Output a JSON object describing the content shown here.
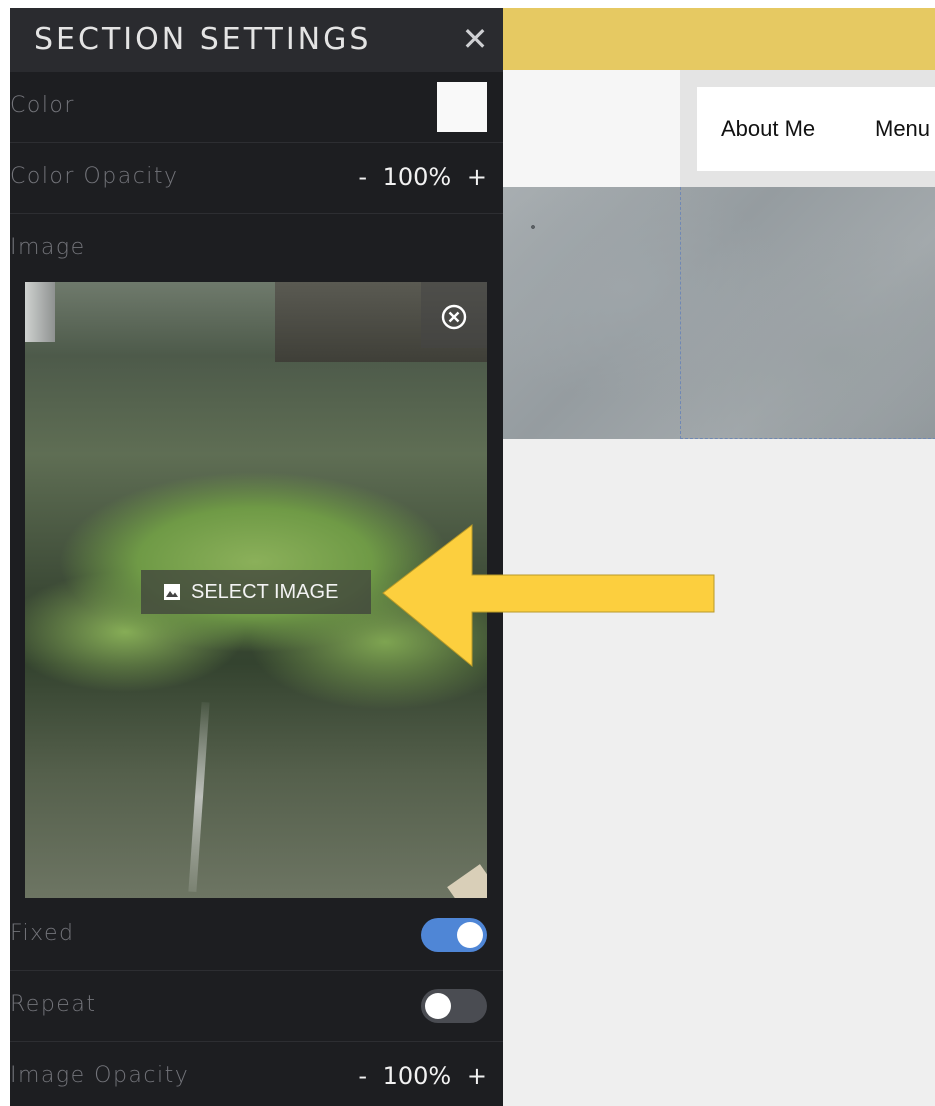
{
  "panel": {
    "title": "SECTION SETTINGS",
    "close_icon": "close-icon",
    "rows": {
      "color": {
        "label": "Color",
        "swatch_color": "#f9f9f9"
      },
      "color_opacity": {
        "label": "Color Opacity",
        "minus": "-",
        "value": "100%",
        "plus": "+"
      },
      "image": {
        "label": "Image",
        "select_image_label": "SELECT IMAGE",
        "select_icon": "image-icon",
        "remove_icon": "remove-circle-icon"
      },
      "fixed": {
        "label": "Fixed",
        "enabled": true
      },
      "repeat": {
        "label": "Repeat",
        "enabled": false
      },
      "image_opacity": {
        "label": "Image Opacity",
        "minus": "-",
        "value": "100%",
        "plus": "+"
      }
    }
  },
  "site_preview": {
    "nav_items": [
      "About Me",
      "Menu"
    ],
    "header_color": "#e6c962"
  },
  "colors": {
    "accent": "#4f86d6",
    "callout": "#fccf3e"
  }
}
